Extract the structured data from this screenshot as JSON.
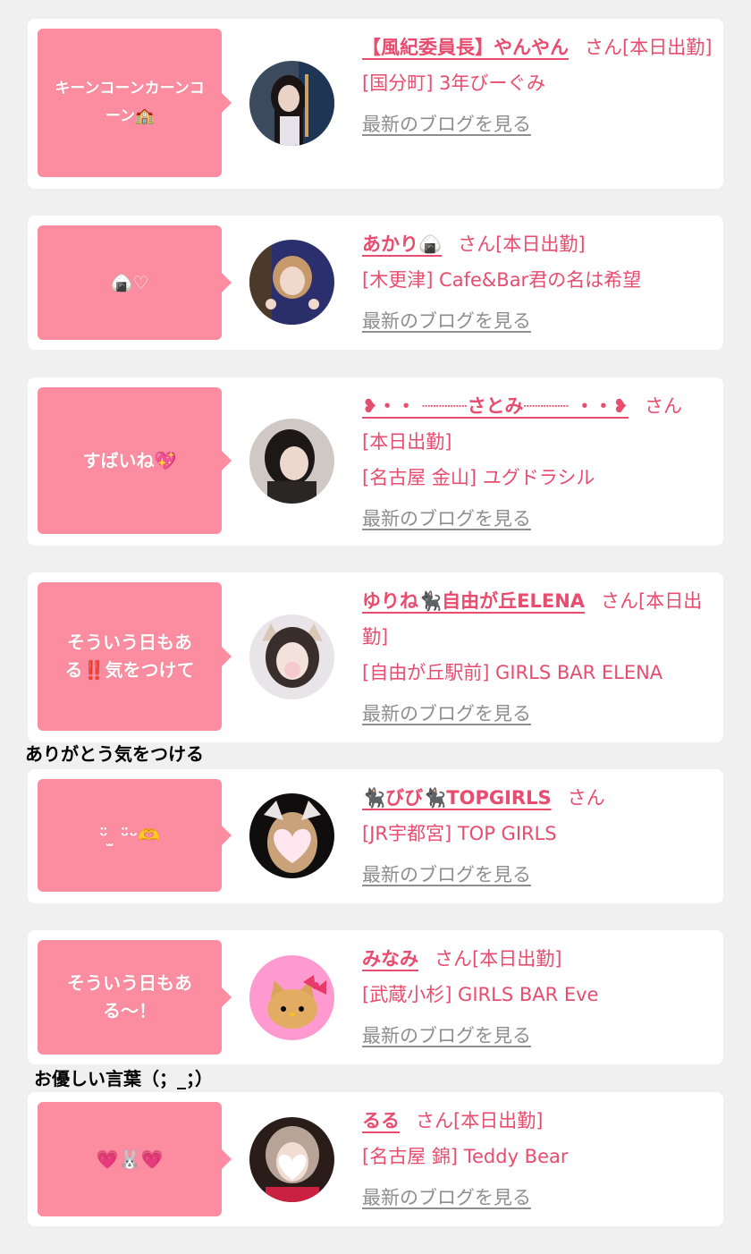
{
  "suffix": "さん",
  "blog_link_label": "最新のブログを見る",
  "colors": {
    "background": "#f0f0f0",
    "card": "#ffffff",
    "bubble": "#fc8da1",
    "name": "#e84c6e",
    "link": "#8e8e8e"
  },
  "entries": [
    {
      "bubble": "キーンコーンカーンコーン🏫",
      "name": "【風紀委員長】やんやん",
      "status": "[本日出勤]",
      "shop": "[国分町] 3年びーぐみ",
      "avatar_icon": "portrait-dark-hair-icon"
    },
    {
      "bubble": "🍙♡",
      "name": "あかり🍙",
      "status": "[本日出勤]",
      "shop": "[木更津] Cafe&Bar君の名は希望",
      "avatar_icon": "portrait-peace-sign-icon"
    },
    {
      "bubble": "すばいね💖",
      "name": "❥・・ ┈┈┈┈さとみ┈┈┈┈ ・・❥",
      "status": "[本日出勤]",
      "shop": "[名古屋 金山] ユグドラシル",
      "avatar_icon": "portrait-short-hair-icon"
    },
    {
      "bubble": "そういう日もある‼️気をつけて",
      "name": "ゆりね🐈‍⬛自由が丘ELENA",
      "status": "[本日出勤]",
      "shop": "[自由が丘駅前] GIRLS BAR ELENA",
      "avatar_icon": "portrait-cat-ears-icon"
    },
    {
      "bubble": "ᵕ̈ ̫ ᵕ̈ᵕ🫶",
      "name": "🐈‍⬛びび🐈‍⬛TOPGIRLS",
      "status": "",
      "shop": "[JR宇都宮] TOP GIRLS",
      "avatar_icon": "portrait-heart-face-icon"
    },
    {
      "bubble": "そういう日もある〜！",
      "name": "みなみ",
      "status": "[本日出勤]",
      "shop": "[武蔵小杉] GIRLS BAR Eve",
      "avatar_icon": "kitty-character-icon"
    },
    {
      "bubble": "💗🐰💗",
      "name": "るる",
      "status": "[本日出勤]",
      "shop": "[名古屋 錦] Teddy Bear",
      "avatar_icon": "portrait-heart-mask-icon"
    }
  ],
  "notes": [
    "ありがとう気をつける",
    "お優しい言葉（；_；）"
  ]
}
